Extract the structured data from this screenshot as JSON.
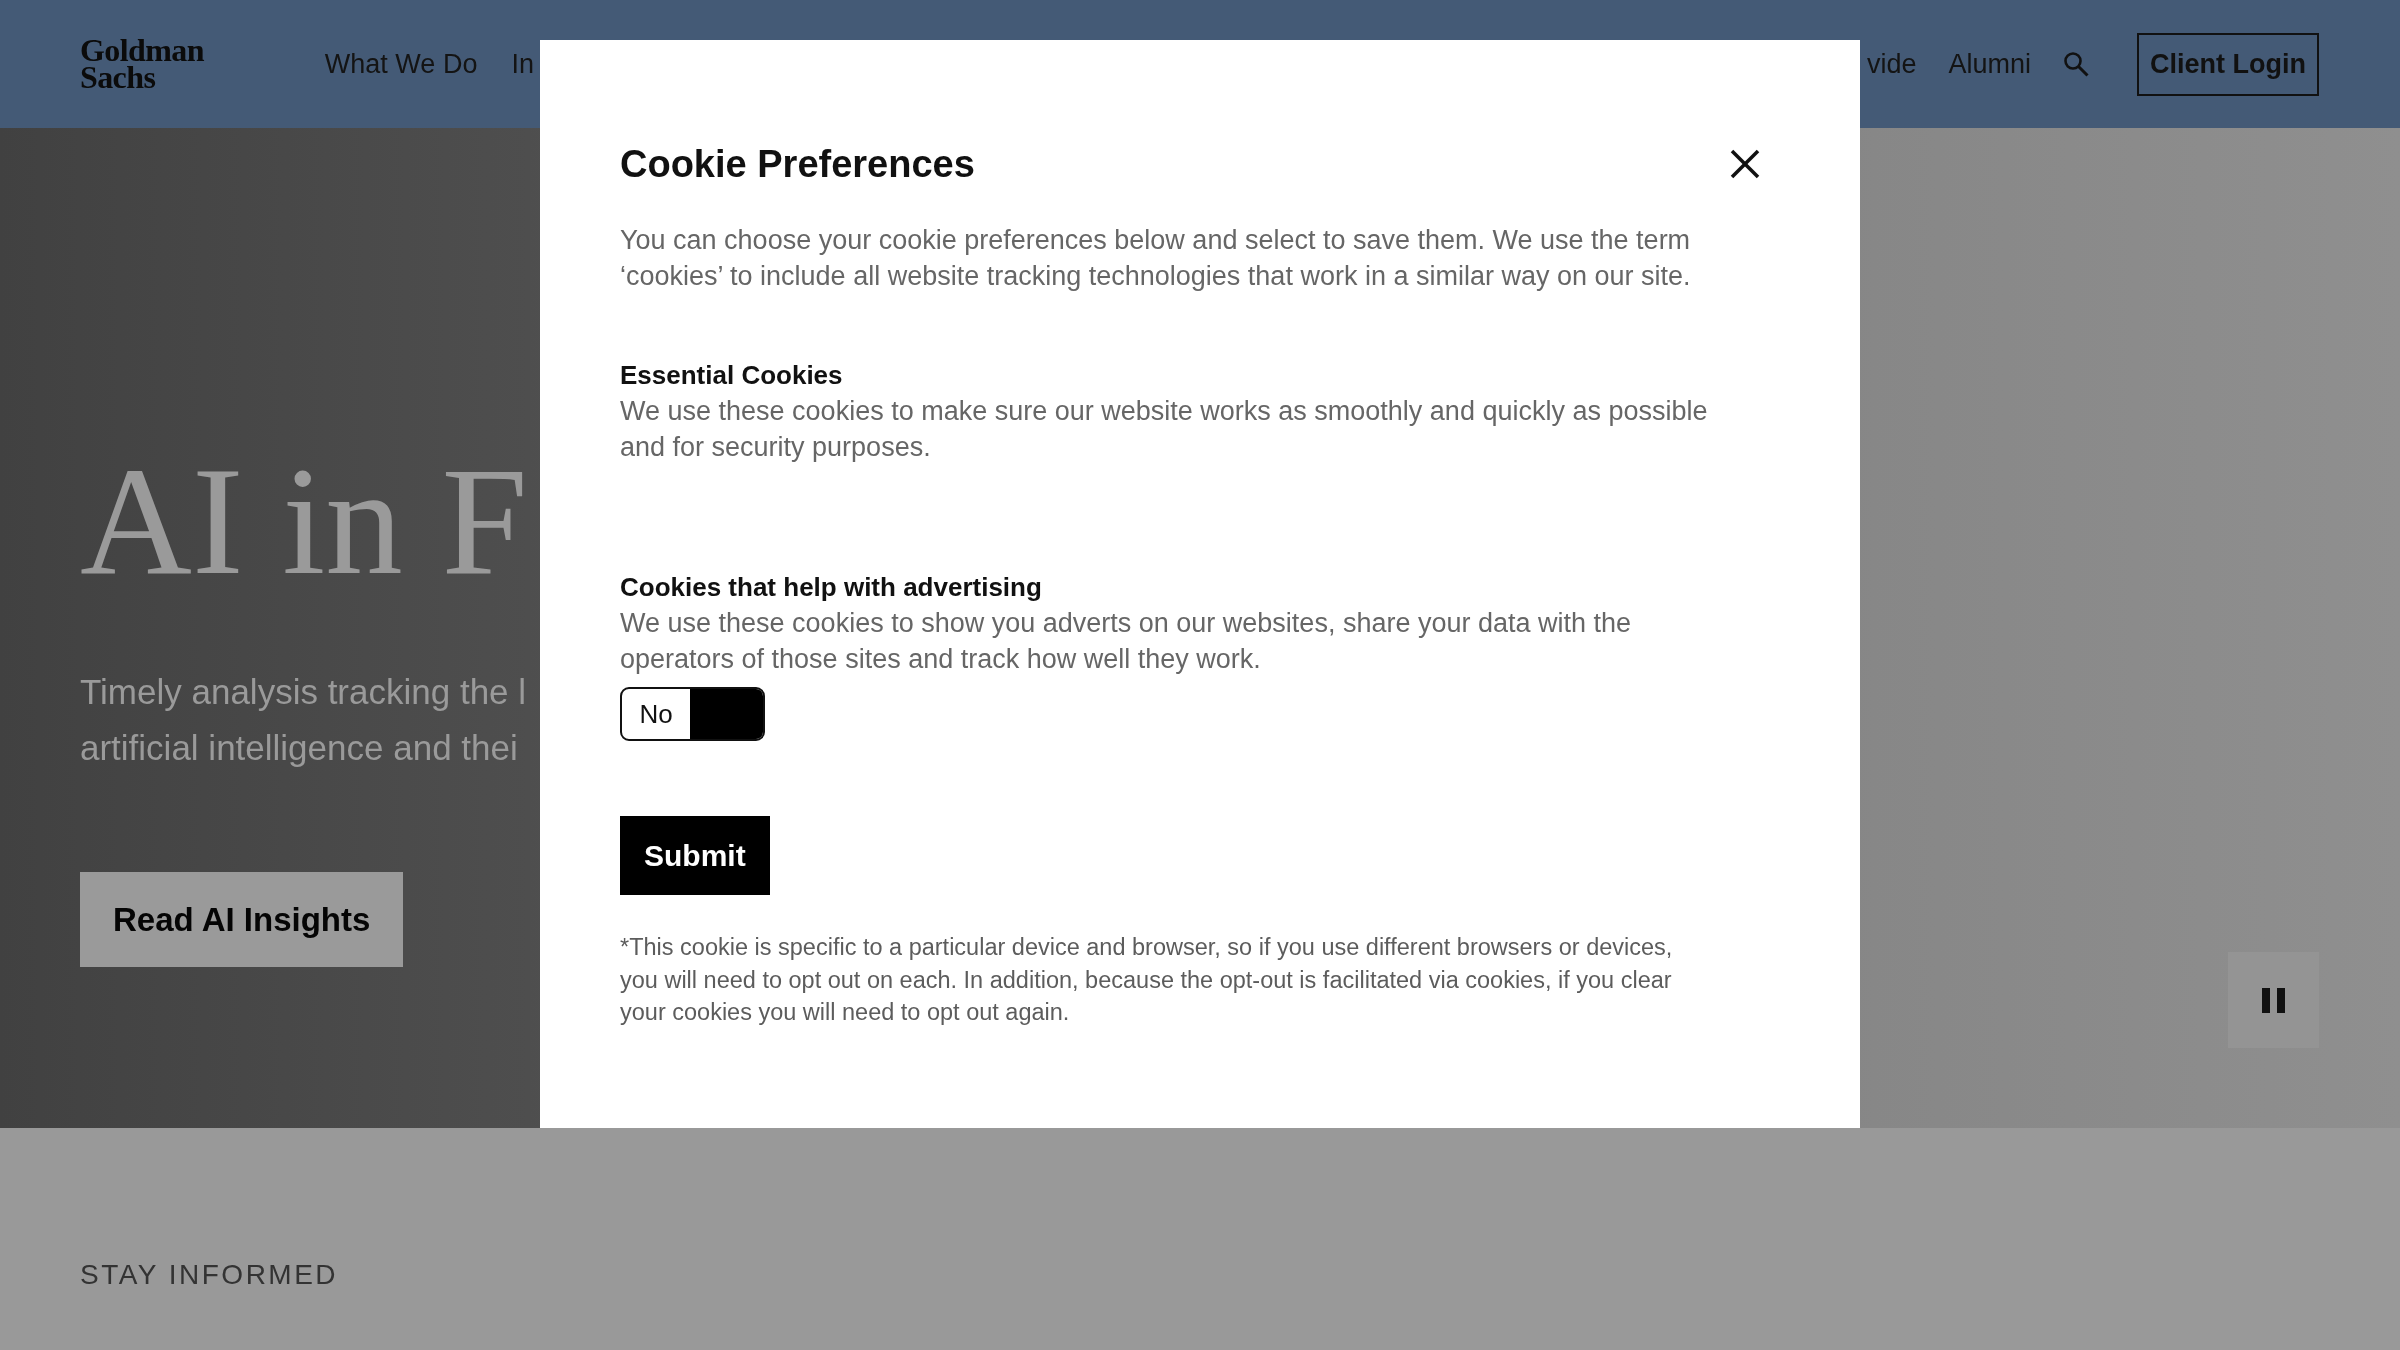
{
  "header": {
    "logo": "Goldman Sachs",
    "nav_left": [
      "What We Do",
      "In"
    ],
    "nav_right": [
      "vide",
      "Alumni"
    ],
    "client_login": "Client Login"
  },
  "hero": {
    "title": "AI in F",
    "subtitle_lines": [
      "Timely analysis tracking the l",
      "artificial intelligence and thei"
    ],
    "button": "Read AI Insights"
  },
  "section": {
    "eyebrow": "STAY INFORMED"
  },
  "dialog": {
    "title": "Cookie Preferences",
    "intro": "You can choose your cookie preferences below and select to save them. We use the term ‘cookies’ to include all website tracking technologies that work in a similar way on our site.",
    "categories": [
      {
        "kind": "info",
        "title": "Essential Cookies",
        "description": "We use these cookies to make sure our website works as smoothly and quickly as possible and for security purposes."
      },
      {
        "kind": "toggle",
        "title": "Cookies that help with advertising",
        "description": "We use these cookies to show you adverts on our websites, share your data with the operators of those sites and track how well they work.",
        "toggle": {
          "label": "No",
          "on": false
        }
      }
    ],
    "submit": "Submit",
    "footnote": "*This cookie is specific to a particular device and browser, so if you use different browsers or devices, you will need to opt out on each. In addition, because the opt-out is facilitated via cookies, if you clear your cookies you will need to opt out again."
  }
}
